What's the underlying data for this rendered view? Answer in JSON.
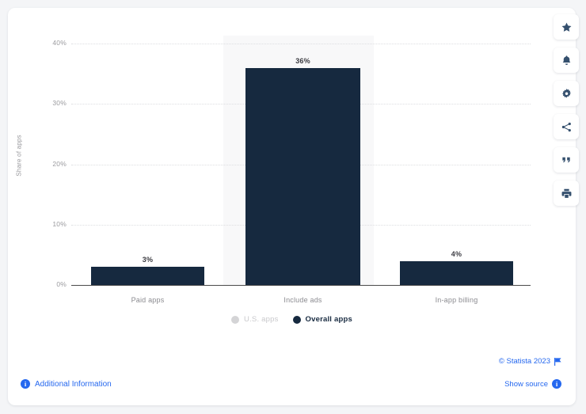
{
  "chart_data": {
    "type": "bar",
    "title": "",
    "subtitle": "",
    "xlabel": "",
    "ylabel": "Share of apps",
    "categories": [
      "Paid apps",
      "Include ads",
      "In-app billing"
    ],
    "series": [
      {
        "name": "U.S. apps",
        "active": false,
        "color": "#d4d4d6",
        "values": [
          null,
          null,
          null
        ]
      },
      {
        "name": "Overall apps",
        "active": true,
        "color": "#16293f",
        "values": [
          3,
          36,
          4
        ]
      }
    ],
    "value_labels": [
      "3%",
      "36%",
      "4%"
    ],
    "yticks": [
      0,
      10,
      20,
      30,
      40
    ],
    "ytick_labels": [
      "0%",
      "10%",
      "20%",
      "30%",
      "40%"
    ],
    "ylim": [
      0,
      40
    ],
    "grid": true,
    "legend_position": "bottom",
    "highlighted_category": "Include ads"
  },
  "legend": {
    "items": [
      {
        "label": "U.S. apps",
        "active": false
      },
      {
        "label": "Overall apps",
        "active": true
      }
    ]
  },
  "footer": {
    "copyright": "© Statista 2023",
    "show_source": "Show source",
    "additional_information": "Additional Information",
    "info_glyph": "i"
  },
  "toolbar": {
    "items": [
      {
        "name": "favorite-star",
        "label": "star-icon"
      },
      {
        "name": "notifications",
        "label": "bell-icon"
      },
      {
        "name": "settings",
        "label": "gear-icon"
      },
      {
        "name": "share",
        "label": "share-icon"
      },
      {
        "name": "citation",
        "label": "quote-icon"
      },
      {
        "name": "print",
        "label": "print-icon"
      }
    ]
  },
  "colors": {
    "bar": "#16293f",
    "inactive": "#d4d4d6",
    "link": "#2568ef",
    "page_bg": "#f4f5f7",
    "card_bg": "#ffffff",
    "highlight_band": "#f8f8f9"
  }
}
